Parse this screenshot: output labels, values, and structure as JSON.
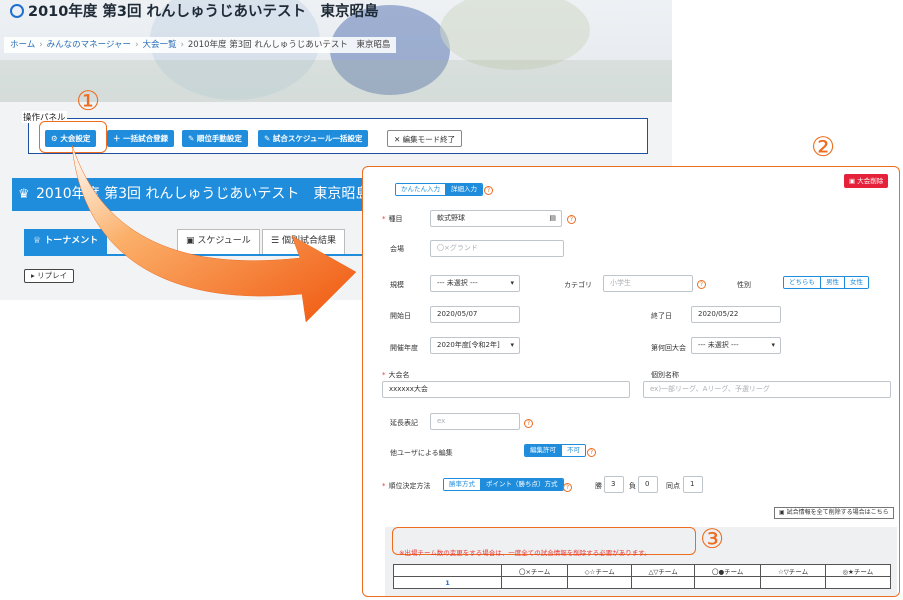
{
  "background_page": {
    "title": "2010年度 第3回 れんしゅうじあいテスト　東京昭島",
    "breadcrumb": [
      "ホーム",
      "みんなのマネージャー",
      "大会一覧",
      "2010年度 第3回 れんしゅうじあいテスト　東京昭島"
    ],
    "operation_panel": {
      "label": "操作パネル",
      "buttons": [
        "大会設定",
        "一括試合登録",
        "順位手動設定",
        "試合スケジュール一括設定",
        "編集モード終了"
      ]
    },
    "tournament_title": "2010年度 第3回 れんしゅうじあいテスト　東京昭島",
    "tabs": [
      "トーナメント",
      "スケジュール",
      "個別試合結果"
    ],
    "replay_button": "リプレイ"
  },
  "annotations": {
    "callout1": "①",
    "callout2": "②",
    "callout3": "③",
    "accent_color": "#ee6c1f"
  },
  "settings_form": {
    "mode_toggle": {
      "simple": "かんたん入力",
      "detailed": "詳細入力"
    },
    "delete_button": "大会削除",
    "event": {
      "label": "種目",
      "value": "軟式野球"
    },
    "venue": {
      "label": "会場",
      "placeholder": "〇×グランド"
    },
    "scale": {
      "label": "規模",
      "value": "--- 未選択 ---"
    },
    "category": {
      "label": "カテゴリ",
      "placeholder": "小学生"
    },
    "gender": {
      "label": "性別",
      "options": [
        "どちらも",
        "男性",
        "女性"
      ]
    },
    "start_date": {
      "label": "開始日",
      "value": "2020/05/07"
    },
    "end_date": {
      "label": "終了日",
      "value": "2020/05/22"
    },
    "fiscal_year": {
      "label": "開催年度",
      "value": "2020年度[令和2年]"
    },
    "edition": {
      "label": "第何回大会",
      "value": "--- 未選択 ---"
    },
    "tournament_name": {
      "label": "大会名",
      "value": "xxxxxx大会"
    },
    "alt_name": {
      "label": "個別名称",
      "placeholder": "ex)一部リーグ、Aリーグ、予選リーグ"
    },
    "overtime": {
      "label": "延長表記",
      "placeholder": "ex"
    },
    "other_user_edit": {
      "label": "他ユーザによる編集",
      "options": [
        "編集許可",
        "不可"
      ]
    },
    "ranking_method": {
      "label": "順位決定方法",
      "options": [
        "勝率方式",
        "ポイント（勝ち点）方式"
      ],
      "win_label": "勝",
      "win": "3",
      "loss_label": "負",
      "loss": "0",
      "draw_label": "同点",
      "draw": "1"
    },
    "bulk_delete_button": "試合情報を全て削除する場合はこちら",
    "notice": "※出場チーム数の変更をする場合は、一度全ての試合情報を削除する必要があります。",
    "table_headers": [
      "〇×チーム",
      "◇☆チーム",
      "△▽チーム",
      "〇●チーム",
      "☆▽チーム",
      "◎★チーム"
    ],
    "table_first_row": "1"
  }
}
